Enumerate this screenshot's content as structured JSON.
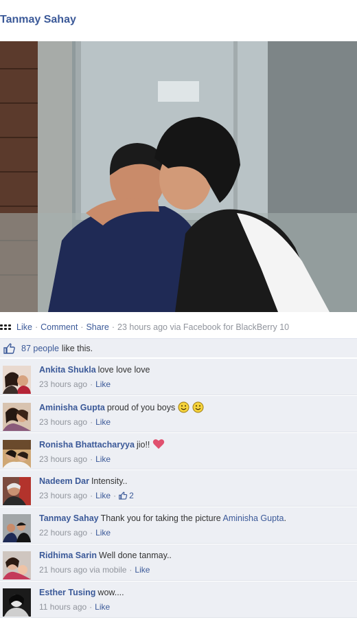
{
  "post": {
    "author": "Tanmay Sahay"
  },
  "actions": {
    "like": "Like",
    "comment": "Comment",
    "share": "Share",
    "time": "23 hours ago via Facebook for BlackBerry 10"
  },
  "likes": {
    "count_link": "87 people",
    "rest": "like this."
  },
  "comments": [
    {
      "author": "Ankita Shukla",
      "text": "love love love",
      "time": "23 hours ago",
      "like": "Like"
    },
    {
      "author": "Aminisha Gupta",
      "text": "proud of you boys",
      "emoji": [
        "smiley-icon",
        "smiley-icon"
      ],
      "time": "23 hours ago",
      "like": "Like"
    },
    {
      "author": "Ronisha Bhattacharyya",
      "text": "jio!!",
      "emoji": [
        "heart-icon"
      ],
      "time": "23 hours ago",
      "like": "Like"
    },
    {
      "author": "Nadeem Dar",
      "text": "Intensity..",
      "time": "23 hours ago",
      "like": "Like",
      "like_count": "2"
    },
    {
      "author": "Tanmay Sahay",
      "text": "Thank you for taking the picture",
      "mention": "Aminisha Gupta",
      "mention_suffix": ".",
      "time": "22 hours ago",
      "like": "Like"
    },
    {
      "author": "Ridhima Sarin",
      "text": "Well done tanmay..",
      "time": "21 hours ago via mobile",
      "like": "Like"
    },
    {
      "author": "Esther Tusing",
      "text": "wow....",
      "time": "11 hours ago",
      "like": "Like"
    }
  ],
  "separator": "·",
  "colors": {
    "link": "#3b5998",
    "meta": "#90949c",
    "comment_bg": "#edeff4",
    "heart": "#e0506e",
    "smiley": "#f5d33c"
  }
}
